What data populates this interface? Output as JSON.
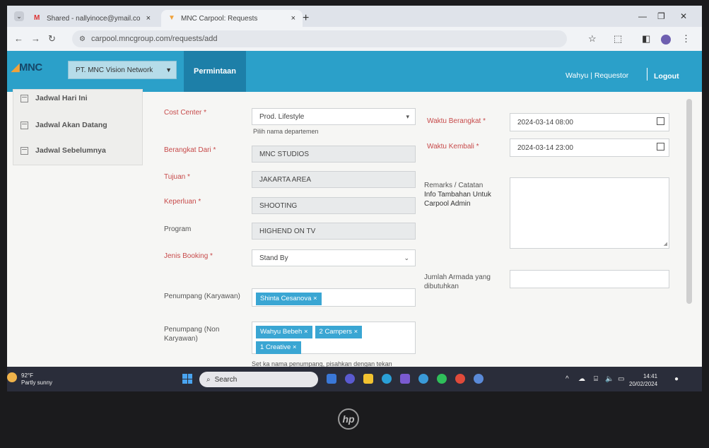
{
  "browser": {
    "tabs": [
      {
        "label": "Shared - nallyinoce@ymail.co",
        "close": "×"
      },
      {
        "label": "MNC Carpool: Requests",
        "close": "×"
      }
    ],
    "new_tab": "+",
    "url": "carpool.mncgroup.com/requests/add"
  },
  "app": {
    "logo": "MNC",
    "org_select": "PT. MNC Vision Network",
    "nav_tab": "Permintaan",
    "user": "Wahyu | Requestor",
    "logout": "Logout"
  },
  "sidebar": {
    "items": [
      {
        "label": "Jadwal Hari Ini"
      },
      {
        "label": "Jadwal Akan Datang"
      },
      {
        "label": "Jadwal Sebelumnya"
      }
    ]
  },
  "form": {
    "cost_center": {
      "label": "Cost Center *",
      "value": "Prod. Lifestyle",
      "help": "Pilih nama departemen"
    },
    "berangkat_dari": {
      "label": "Berangkat Dari *",
      "value": "MNC STUDIOS"
    },
    "tujuan": {
      "label": "Tujuan *",
      "value": "JAKARTA AREA"
    },
    "keperluan": {
      "label": "Keperluan *",
      "value": "SHOOTING"
    },
    "program": {
      "label": "Program",
      "value": "HIGHEND ON TV"
    },
    "jenis_booking": {
      "label": "Jenis Booking *",
      "value": "Stand By"
    },
    "penumpang_karyawan": {
      "label": "Penumpang (Karyawan)",
      "tags": [
        "Shinta Cesanova ×"
      ]
    },
    "penumpang_non": {
      "label": "Penumpang (Non Karyawan)",
      "tags": [
        "Wahyu Bebeh ×",
        "2 Campers ×",
        "1 Creative ×"
      ],
      "help": "Set ka nama penumpang, pisahkan dengan tekan"
    },
    "waktu_berangkat": {
      "label": "Waktu Berangkat *",
      "value": "2024-03-14 08:00"
    },
    "waktu_kembali": {
      "label": "Waktu Kembali *",
      "value": "2024-03-14 23:00"
    },
    "remarks": {
      "label": "Remarks / Catatan",
      "sublabel": "Info Tambahan Untuk Carpool Admin"
    },
    "armada": {
      "label": "Jumlah Armada yang dibutuhkan"
    }
  },
  "taskbar": {
    "weather_temp": "92°F",
    "weather_desc": "Partly sunny",
    "search": "Search",
    "time": "14:41",
    "date": "20/02/2024"
  },
  "colors": {
    "header": "#2ba0c9",
    "nav_active": "#1d7fa8",
    "tag": "#3aa6d3",
    "required_label": "#c74a4a"
  }
}
